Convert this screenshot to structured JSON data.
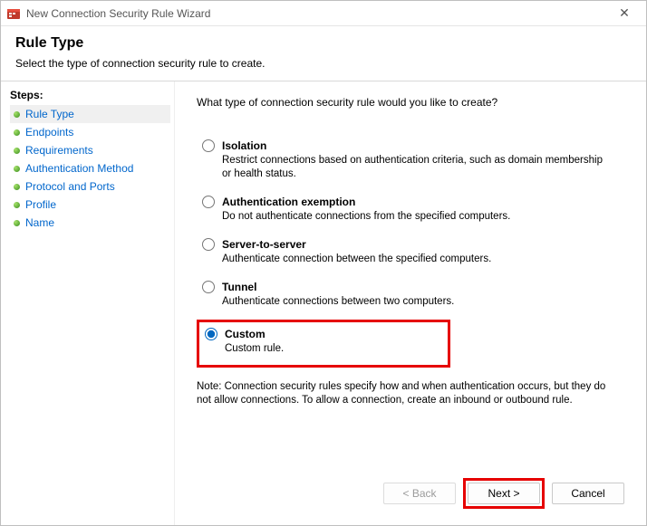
{
  "window": {
    "title": "New Connection Security Rule Wizard"
  },
  "header": {
    "title": "Rule Type",
    "subtitle": "Select the type of connection security rule to create."
  },
  "sidebar": {
    "title": "Steps:",
    "items": [
      {
        "label": "Rule Type"
      },
      {
        "label": "Endpoints"
      },
      {
        "label": "Requirements"
      },
      {
        "label": "Authentication Method"
      },
      {
        "label": "Protocol and Ports"
      },
      {
        "label": "Profile"
      },
      {
        "label": "Name"
      }
    ]
  },
  "main": {
    "question": "What type of connection security rule would you like to create?",
    "options": {
      "isolation": {
        "label": "Isolation",
        "desc": "Restrict connections based on authentication criteria, such as domain membership or health status."
      },
      "auth_exemption": {
        "label": "Authentication exemption",
        "desc": "Do not authenticate connections from the specified computers."
      },
      "server_to_server": {
        "label": "Server-to-server",
        "desc": "Authenticate connection between the specified computers."
      },
      "tunnel": {
        "label": "Tunnel",
        "desc": "Authenticate connections between two computers."
      },
      "custom": {
        "label": "Custom",
        "desc": "Custom rule."
      }
    },
    "note": "Note:  Connection security rules specify how and when authentication occurs, but they do not allow connections.  To allow a connection, create an inbound or outbound rule."
  },
  "buttons": {
    "back": "< Back",
    "next": "Next >",
    "cancel": "Cancel"
  }
}
